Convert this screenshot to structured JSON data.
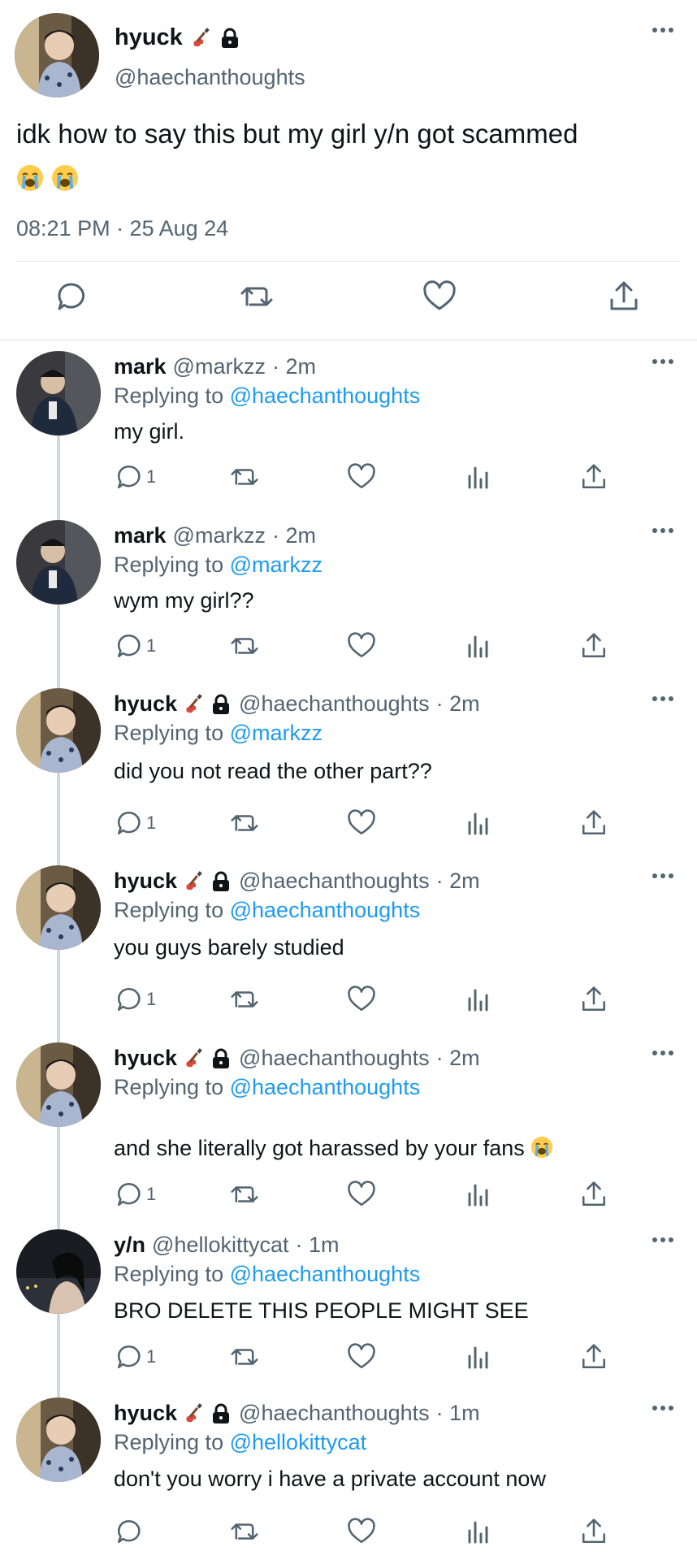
{
  "main_tweet": {
    "name": "hyuck",
    "handle": "@haechanthoughts",
    "text": "idk how to say this but my girl y/n got scammed",
    "text_emojis": [
      "loudly-crying-face",
      "loudly-crying-face"
    ],
    "timestamp": "08:21 PM · 25 Aug 24",
    "badges": [
      "guitar-icon",
      "lock-icon"
    ]
  },
  "replies": [
    {
      "name": "mark",
      "handle": "@markzz",
      "time": "· 2m",
      "replying_prefix": "Replying to",
      "replying_to": "@haechanthoughts",
      "text": "my girl.",
      "reply_count": "1",
      "has_badges": false,
      "avatar": "mark"
    },
    {
      "name": "mark",
      "handle": "@markzz",
      "time": "· 2m",
      "replying_prefix": "Replying to",
      "replying_to": "@markzz",
      "text": "wym my girl??",
      "reply_count": "1",
      "has_badges": false,
      "avatar": "mark"
    },
    {
      "name": "hyuck",
      "handle": "@haechanthoughts",
      "time": "· 2m",
      "replying_prefix": "Replying to",
      "replying_to": "@markzz",
      "text": "did you not read the other part??",
      "reply_count": "1",
      "has_badges": true,
      "avatar": "hyuck"
    },
    {
      "name": "hyuck",
      "handle": "@haechanthoughts",
      "time": "· 2m",
      "replying_prefix": "Replying to",
      "replying_to": "@haechanthoughts",
      "text": "you guys barely studied",
      "reply_count": "1",
      "has_badges": true,
      "avatar": "hyuck"
    },
    {
      "name": "hyuck",
      "handle": "@haechanthoughts",
      "time": "· 2m",
      "replying_prefix": "Replying to",
      "replying_to": "@haechanthoughts",
      "text": "and she literally got harassed by your fans",
      "text_emoji": "loudly-crying-face",
      "reply_count": "1",
      "has_badges": true,
      "avatar": "hyuck"
    },
    {
      "name": "y/n",
      "handle": "@hellokittycat",
      "time": "· 1m",
      "replying_prefix": "Replying to",
      "replying_to": "@haechanthoughts",
      "text": "BRO DELETE THIS PEOPLE MIGHT SEE",
      "reply_count": "1",
      "has_badges": false,
      "avatar": "yn"
    },
    {
      "name": "hyuck",
      "handle": "@haechanthoughts",
      "time": "· 1m",
      "replying_prefix": "Replying to",
      "replying_to": "@hellokittycat",
      "text": "don't you worry i have a private account now",
      "reply_count": "",
      "has_badges": true,
      "avatar": "hyuck"
    }
  ],
  "colors": {
    "text": "#0f1419",
    "secondary": "#536471",
    "link": "#1d9bf0",
    "divider": "#e1e4e6",
    "thread_line": "#cfd9de"
  }
}
